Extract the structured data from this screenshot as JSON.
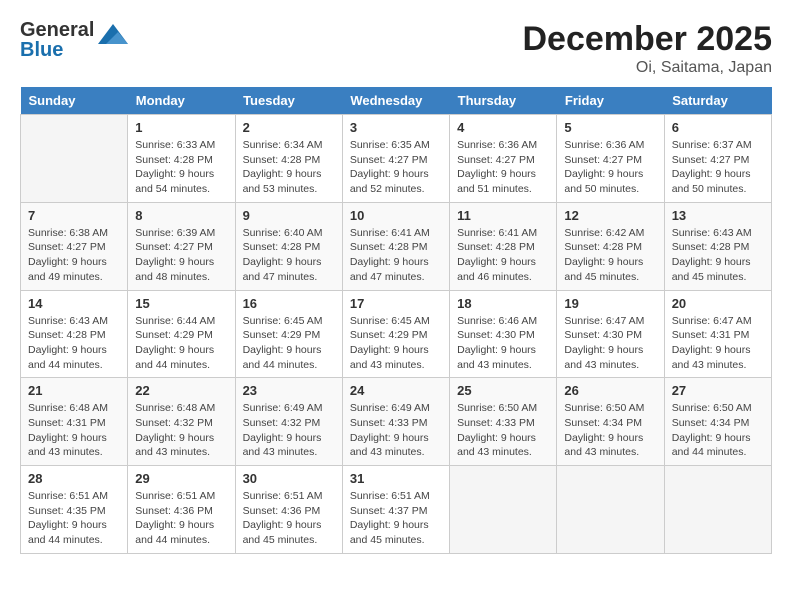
{
  "header": {
    "logo_general": "General",
    "logo_blue": "Blue",
    "title": "December 2025",
    "subtitle": "Oi, Saitama, Japan"
  },
  "days_of_week": [
    "Sunday",
    "Monday",
    "Tuesday",
    "Wednesday",
    "Thursday",
    "Friday",
    "Saturday"
  ],
  "weeks": [
    [
      {
        "day": "",
        "sunrise": "",
        "sunset": "",
        "daylight": ""
      },
      {
        "day": "1",
        "sunrise": "Sunrise: 6:33 AM",
        "sunset": "Sunset: 4:28 PM",
        "daylight": "Daylight: 9 hours and 54 minutes."
      },
      {
        "day": "2",
        "sunrise": "Sunrise: 6:34 AM",
        "sunset": "Sunset: 4:28 PM",
        "daylight": "Daylight: 9 hours and 53 minutes."
      },
      {
        "day": "3",
        "sunrise": "Sunrise: 6:35 AM",
        "sunset": "Sunset: 4:27 PM",
        "daylight": "Daylight: 9 hours and 52 minutes."
      },
      {
        "day": "4",
        "sunrise": "Sunrise: 6:36 AM",
        "sunset": "Sunset: 4:27 PM",
        "daylight": "Daylight: 9 hours and 51 minutes."
      },
      {
        "day": "5",
        "sunrise": "Sunrise: 6:36 AM",
        "sunset": "Sunset: 4:27 PM",
        "daylight": "Daylight: 9 hours and 50 minutes."
      },
      {
        "day": "6",
        "sunrise": "Sunrise: 6:37 AM",
        "sunset": "Sunset: 4:27 PM",
        "daylight": "Daylight: 9 hours and 50 minutes."
      }
    ],
    [
      {
        "day": "7",
        "sunrise": "Sunrise: 6:38 AM",
        "sunset": "Sunset: 4:27 PM",
        "daylight": "Daylight: 9 hours and 49 minutes."
      },
      {
        "day": "8",
        "sunrise": "Sunrise: 6:39 AM",
        "sunset": "Sunset: 4:27 PM",
        "daylight": "Daylight: 9 hours and 48 minutes."
      },
      {
        "day": "9",
        "sunrise": "Sunrise: 6:40 AM",
        "sunset": "Sunset: 4:28 PM",
        "daylight": "Daylight: 9 hours and 47 minutes."
      },
      {
        "day": "10",
        "sunrise": "Sunrise: 6:41 AM",
        "sunset": "Sunset: 4:28 PM",
        "daylight": "Daylight: 9 hours and 47 minutes."
      },
      {
        "day": "11",
        "sunrise": "Sunrise: 6:41 AM",
        "sunset": "Sunset: 4:28 PM",
        "daylight": "Daylight: 9 hours and 46 minutes."
      },
      {
        "day": "12",
        "sunrise": "Sunrise: 6:42 AM",
        "sunset": "Sunset: 4:28 PM",
        "daylight": "Daylight: 9 hours and 45 minutes."
      },
      {
        "day": "13",
        "sunrise": "Sunrise: 6:43 AM",
        "sunset": "Sunset: 4:28 PM",
        "daylight": "Daylight: 9 hours and 45 minutes."
      }
    ],
    [
      {
        "day": "14",
        "sunrise": "Sunrise: 6:43 AM",
        "sunset": "Sunset: 4:28 PM",
        "daylight": "Daylight: 9 hours and 44 minutes."
      },
      {
        "day": "15",
        "sunrise": "Sunrise: 6:44 AM",
        "sunset": "Sunset: 4:29 PM",
        "daylight": "Daylight: 9 hours and 44 minutes."
      },
      {
        "day": "16",
        "sunrise": "Sunrise: 6:45 AM",
        "sunset": "Sunset: 4:29 PM",
        "daylight": "Daylight: 9 hours and 44 minutes."
      },
      {
        "day": "17",
        "sunrise": "Sunrise: 6:45 AM",
        "sunset": "Sunset: 4:29 PM",
        "daylight": "Daylight: 9 hours and 43 minutes."
      },
      {
        "day": "18",
        "sunrise": "Sunrise: 6:46 AM",
        "sunset": "Sunset: 4:30 PM",
        "daylight": "Daylight: 9 hours and 43 minutes."
      },
      {
        "day": "19",
        "sunrise": "Sunrise: 6:47 AM",
        "sunset": "Sunset: 4:30 PM",
        "daylight": "Daylight: 9 hours and 43 minutes."
      },
      {
        "day": "20",
        "sunrise": "Sunrise: 6:47 AM",
        "sunset": "Sunset: 4:31 PM",
        "daylight": "Daylight: 9 hours and 43 minutes."
      }
    ],
    [
      {
        "day": "21",
        "sunrise": "Sunrise: 6:48 AM",
        "sunset": "Sunset: 4:31 PM",
        "daylight": "Daylight: 9 hours and 43 minutes."
      },
      {
        "day": "22",
        "sunrise": "Sunrise: 6:48 AM",
        "sunset": "Sunset: 4:32 PM",
        "daylight": "Daylight: 9 hours and 43 minutes."
      },
      {
        "day": "23",
        "sunrise": "Sunrise: 6:49 AM",
        "sunset": "Sunset: 4:32 PM",
        "daylight": "Daylight: 9 hours and 43 minutes."
      },
      {
        "day": "24",
        "sunrise": "Sunrise: 6:49 AM",
        "sunset": "Sunset: 4:33 PM",
        "daylight": "Daylight: 9 hours and 43 minutes."
      },
      {
        "day": "25",
        "sunrise": "Sunrise: 6:50 AM",
        "sunset": "Sunset: 4:33 PM",
        "daylight": "Daylight: 9 hours and 43 minutes."
      },
      {
        "day": "26",
        "sunrise": "Sunrise: 6:50 AM",
        "sunset": "Sunset: 4:34 PM",
        "daylight": "Daylight: 9 hours and 43 minutes."
      },
      {
        "day": "27",
        "sunrise": "Sunrise: 6:50 AM",
        "sunset": "Sunset: 4:34 PM",
        "daylight": "Daylight: 9 hours and 44 minutes."
      }
    ],
    [
      {
        "day": "28",
        "sunrise": "Sunrise: 6:51 AM",
        "sunset": "Sunset: 4:35 PM",
        "daylight": "Daylight: 9 hours and 44 minutes."
      },
      {
        "day": "29",
        "sunrise": "Sunrise: 6:51 AM",
        "sunset": "Sunset: 4:36 PM",
        "daylight": "Daylight: 9 hours and 44 minutes."
      },
      {
        "day": "30",
        "sunrise": "Sunrise: 6:51 AM",
        "sunset": "Sunset: 4:36 PM",
        "daylight": "Daylight: 9 hours and 45 minutes."
      },
      {
        "day": "31",
        "sunrise": "Sunrise: 6:51 AM",
        "sunset": "Sunset: 4:37 PM",
        "daylight": "Daylight: 9 hours and 45 minutes."
      },
      {
        "day": "",
        "sunrise": "",
        "sunset": "",
        "daylight": ""
      },
      {
        "day": "",
        "sunrise": "",
        "sunset": "",
        "daylight": ""
      },
      {
        "day": "",
        "sunrise": "",
        "sunset": "",
        "daylight": ""
      }
    ]
  ]
}
